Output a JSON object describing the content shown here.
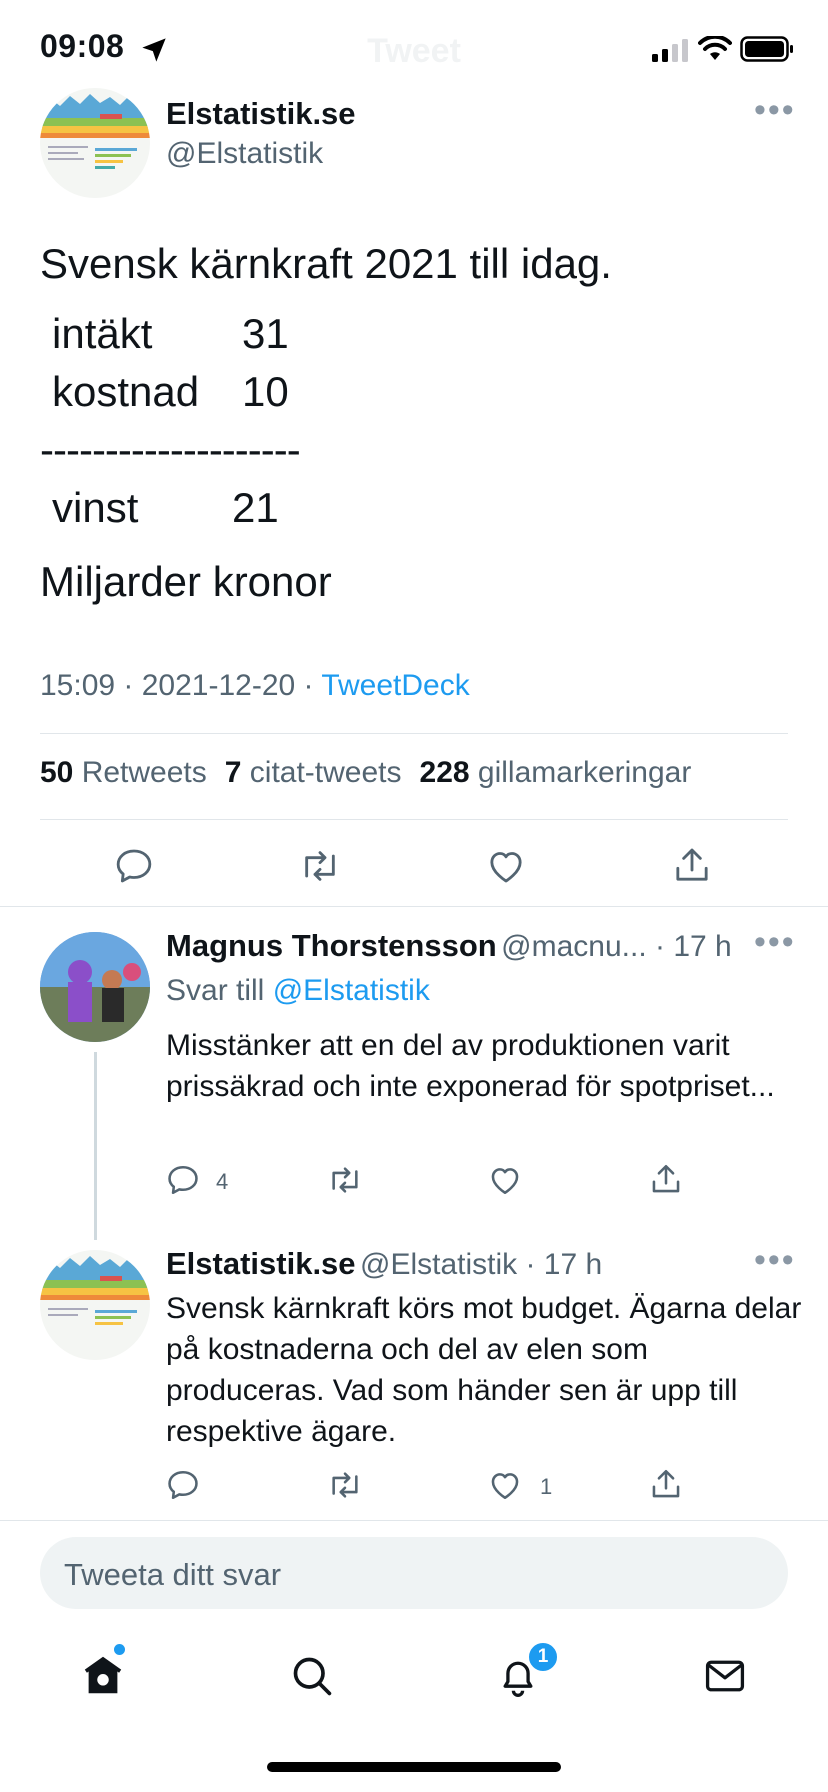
{
  "status_bar": {
    "time": "09:08",
    "ghost_title": "Tweet"
  },
  "main_tweet": {
    "display_name": "Elstatistik.se",
    "handle": "@Elstatistik",
    "text_line1": "Svensk kärnkraft 2021 till idag.",
    "table": [
      {
        "label": "intäkt",
        "value": "31"
      },
      {
        "label": "kostnad",
        "value": "10"
      }
    ],
    "separator": "--------------------",
    "total": {
      "label": "vinst",
      "value": "21"
    },
    "unit_line": "Miljarder kronor",
    "meta_time": "15:09 · 2021-12-20 · ",
    "meta_source": "TweetDeck"
  },
  "stats": {
    "retweets_count": "50",
    "retweets_label": " Retweets",
    "quotes_count": "7",
    "quotes_label": " citat-tweets",
    "likes_count": "228",
    "likes_label": " gillamarkeringar"
  },
  "replies": [
    {
      "display_name": "Magnus Thorstensson",
      "handle_time": "@macnu... · 17 h",
      "reply_to_prefix": "Svar till ",
      "reply_to_handle": "@Elstatistik",
      "text": "Misstänker att en del av produktionen varit prissäkrad och inte exponerad för spotpriset...",
      "reply_count": "4",
      "like_count": ""
    },
    {
      "display_name": "Elstatistik.se",
      "handle_time": "@Elstatistik · 17 h",
      "text": "Svensk kärnkraft körs mot budget. Ägarna delar på kostnaderna och del av elen som produceras. Vad som händer sen är upp till respektive ägare.",
      "reply_count": "",
      "like_count": "1"
    }
  ],
  "composer": {
    "placeholder": "Tweeta ditt svar"
  },
  "tab_bar": {
    "notifications_badge": "1"
  },
  "colors": {
    "accent": "#1d9bf0",
    "text": "#0f1419",
    "muted": "#536471",
    "divider": "#e1e6ea"
  },
  "icons": [
    "location-arrow-icon",
    "signal-icon",
    "wifi-icon",
    "battery-icon",
    "more-icon",
    "reply-icon",
    "retweet-icon",
    "like-icon",
    "share-icon",
    "home-icon",
    "search-icon",
    "bell-icon",
    "mail-icon"
  ]
}
